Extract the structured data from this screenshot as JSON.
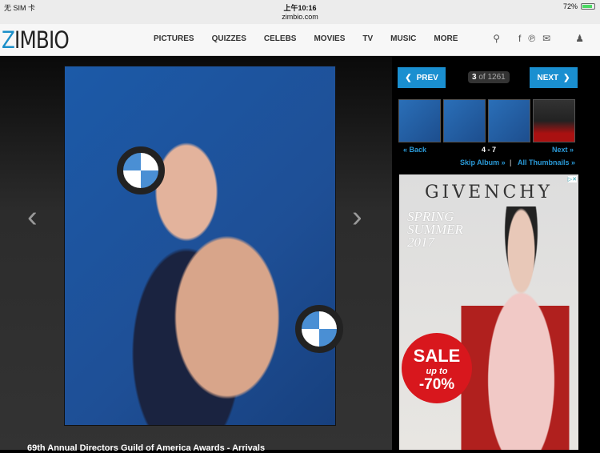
{
  "status": {
    "carrier": "无 SIM 卡",
    "time": "上午10:16",
    "url": "zimbio.com",
    "battery": "72%",
    "battery_level": 0.72
  },
  "nav": {
    "logo_z": "Z",
    "logo_rest": "IMBIO",
    "items": [
      "PICTURES",
      "QUIZZES",
      "CELEBS",
      "MOVIES",
      "TV",
      "MUSIC",
      "MORE"
    ],
    "icons": [
      "search-icon",
      "facebook-icon",
      "pinterest-icon",
      "email-icon",
      "user-icon"
    ]
  },
  "gallery": {
    "caption": "69th Annual Directors Guild of America Awards - Arrivals",
    "prev": "PREV",
    "next": "NEXT",
    "current": "3",
    "of": "of 1261",
    "back": "« Back",
    "range": "4 - 7",
    "next_link": "Next »",
    "skip": "Skip Album »",
    "sep": "|",
    "all": "All Thumbnails »"
  },
  "ad": {
    "brand": "GIVENCHY",
    "season1": "SPRING",
    "season2": "SUMMER",
    "season3": "2017",
    "sale": "SALE",
    "upto": "up to",
    "pct": "-70%",
    "badge": "▷✕"
  }
}
